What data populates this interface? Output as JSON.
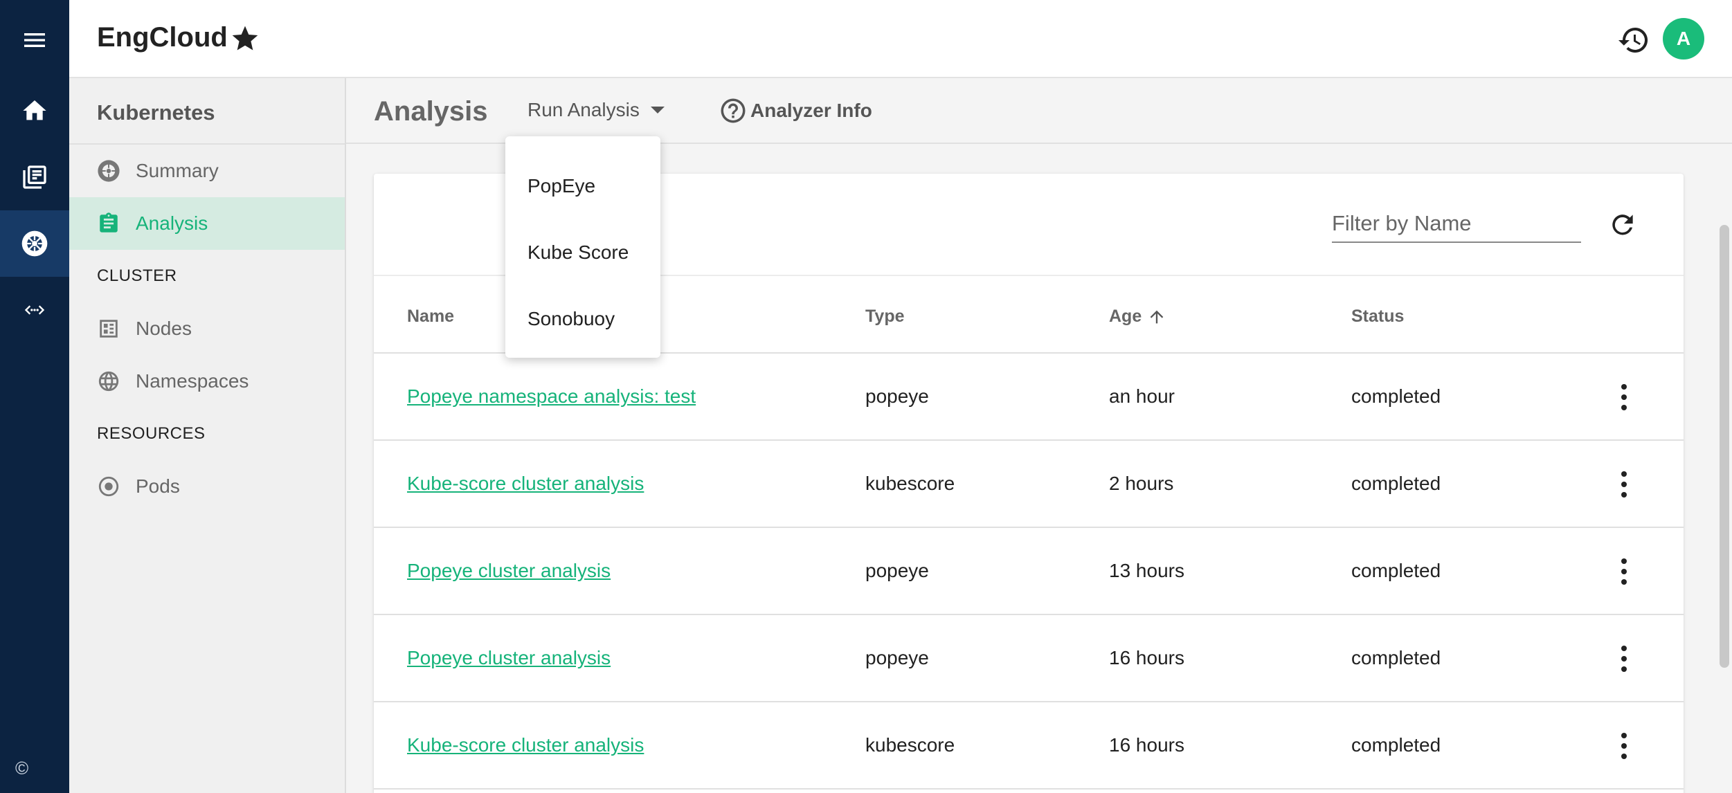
{
  "app": {
    "title": "EngCloud",
    "avatar_initial": "A"
  },
  "rail": {
    "items": [
      {
        "name": "menu-icon"
      },
      {
        "name": "home-icon"
      },
      {
        "name": "news-icon"
      },
      {
        "name": "kubernetes-icon",
        "active": true
      },
      {
        "name": "code-icon"
      }
    ],
    "footer": "©"
  },
  "sidebar": {
    "title": "Kubernetes",
    "items": [
      {
        "label": "Summary",
        "icon": "kubernetes-icon"
      },
      {
        "label": "Analysis",
        "icon": "clipboard-icon",
        "active": true
      }
    ],
    "sections": [
      {
        "title": "CLUSTER",
        "items": [
          {
            "label": "Nodes",
            "icon": "grid-icon"
          },
          {
            "label": "Namespaces",
            "icon": "globe-icon"
          }
        ]
      },
      {
        "title": "RESOURCES",
        "items": [
          {
            "label": "Pods",
            "icon": "radio-icon"
          }
        ]
      }
    ]
  },
  "main": {
    "title": "Analysis",
    "run_button": "Run Analysis",
    "info_button": "Analyzer Info",
    "filter_placeholder": "Filter by Name",
    "menu": [
      "PopEye",
      "Kube Score",
      "Sonobuoy"
    ]
  },
  "table": {
    "headers": {
      "name": "Name",
      "type": "Type",
      "age": "Age",
      "status": "Status"
    },
    "rows": [
      {
        "name": "Popeye namespace analysis: test",
        "type": "popeye",
        "age": "an hour",
        "status": "completed"
      },
      {
        "name": "Kube-score cluster analysis",
        "type": "kubescore",
        "age": "2 hours",
        "status": "completed"
      },
      {
        "name": "Popeye cluster analysis",
        "type": "popeye",
        "age": "13 hours",
        "status": "completed"
      },
      {
        "name": "Popeye cluster analysis",
        "type": "popeye",
        "age": "16 hours",
        "status": "completed"
      },
      {
        "name": "Kube-score cluster analysis",
        "type": "kubescore",
        "age": "16 hours",
        "status": "completed"
      }
    ]
  },
  "colors": {
    "accent": "#16b37a",
    "rail": "#0c2341",
    "avatar": "#1abc7a"
  }
}
